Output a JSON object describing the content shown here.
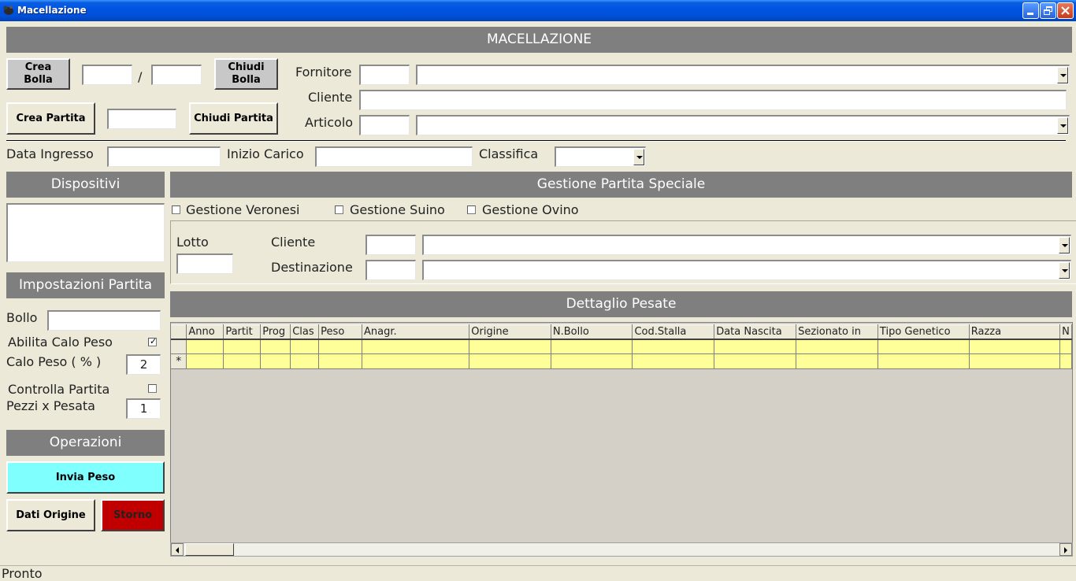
{
  "window": {
    "title": "Macellazione"
  },
  "header": {
    "title": "MACELLAZIONE"
  },
  "bolla": {
    "create_label": "Crea\nBolla",
    "separator": "/",
    "close_label": "Chiudi\nBolla",
    "number": "",
    "year": ""
  },
  "partita": {
    "create_label": "Crea Partita",
    "close_label": "Chiudi Partita",
    "number": ""
  },
  "fornitore": {
    "label": "Fornitore",
    "code": "",
    "name": ""
  },
  "cliente": {
    "label": "Cliente",
    "value": ""
  },
  "articolo": {
    "label": "Articolo",
    "code": "",
    "name": ""
  },
  "data_ingresso": {
    "label": "Data Ingresso",
    "value": ""
  },
  "inizio_carico": {
    "label": "Inizio Carico",
    "value": ""
  },
  "classifica": {
    "label": "Classifica",
    "value": ""
  },
  "dispositivi": {
    "title": "Dispositivi"
  },
  "impostazioni": {
    "title": "Impostazioni Partita",
    "bollo_label": "Bollo",
    "bollo_value": "",
    "abilita_calo_label": "Abilita Calo Peso",
    "abilita_calo_checked": true,
    "calo_label": "Calo Peso ( % )",
    "calo_value": "2",
    "controlla_label": "Controlla Partita",
    "controlla_checked": false,
    "pezzi_label": "Pezzi x Pesata",
    "pezzi_value": "1"
  },
  "operazioni": {
    "title": "Operazioni",
    "invia_label": "Invia Peso",
    "dati_label": "Dati Origine",
    "storno_label": "Storno",
    "invia_color": "#80ffff",
    "storno_color": "#c00000"
  },
  "speciale": {
    "title": "Gestione Partita Speciale",
    "veronesi_label": "Gestione Veronesi",
    "suino_label": "Gestione Suino",
    "ovino_label": "Gestione Ovino",
    "lotto_label": "Lotto",
    "lotto_value": "",
    "cliente_label": "Cliente",
    "destinazione_label": "Destinazione"
  },
  "dettaglio": {
    "title": "Dettaglio Pesate",
    "columns": [
      "Anno",
      "Partit",
      "Prog",
      "Clas",
      "Peso",
      "Anagr.",
      "Origine",
      "N.Bollo",
      "Cod.Stalla",
      "Data Nascita",
      "Sezionato in",
      "Tipo Genetico",
      "Razza",
      "N"
    ],
    "new_row_marker": "*"
  },
  "status": {
    "text": "Pronto"
  }
}
